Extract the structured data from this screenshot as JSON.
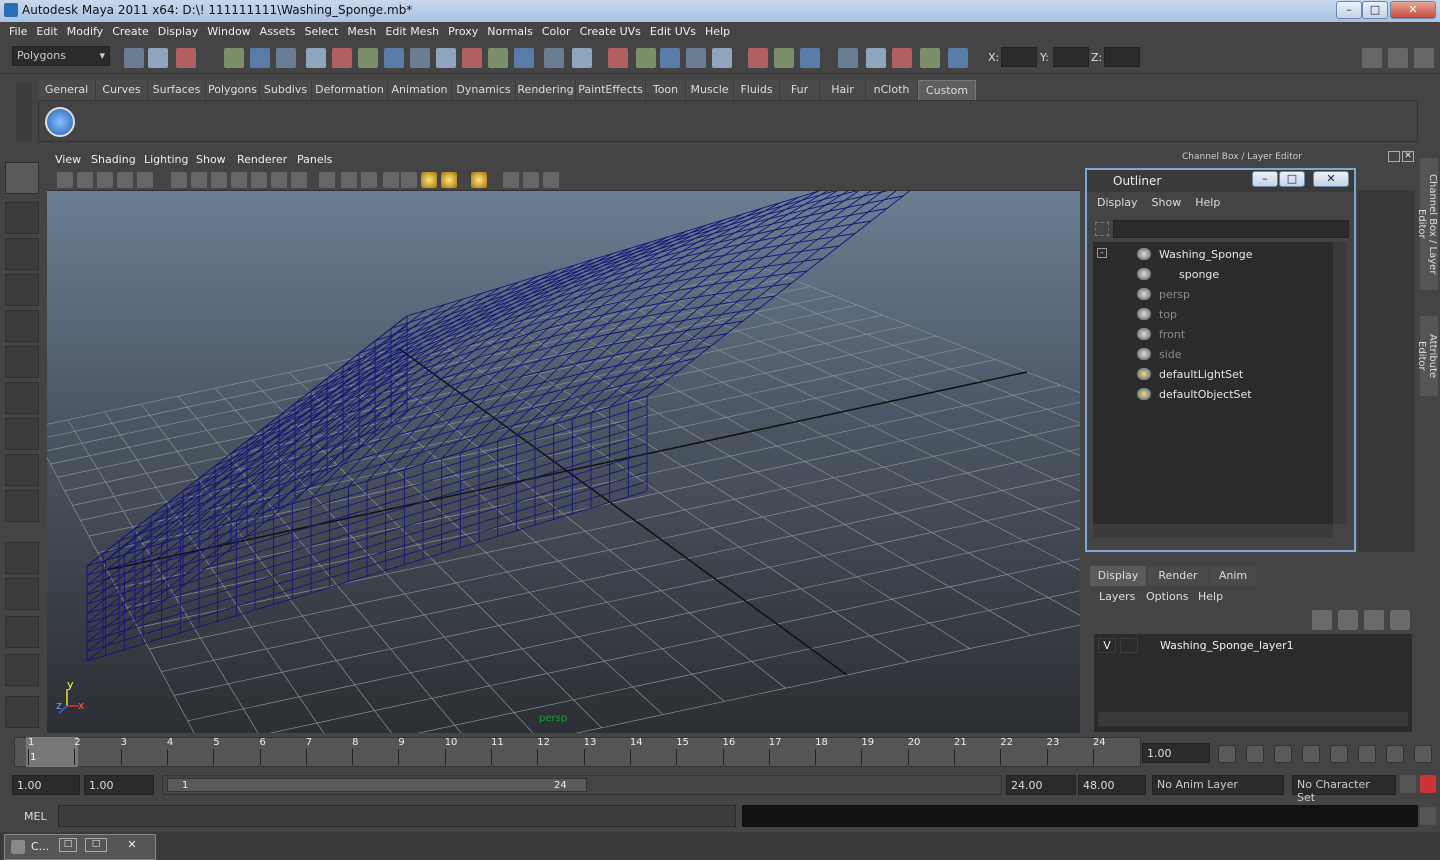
{
  "window": {
    "title": "Autodesk Maya 2011 x64: D:\\! 111111111\\Washing_Sponge.mb*"
  },
  "menubar": [
    "File",
    "Edit",
    "Modify",
    "Create",
    "Display",
    "Window",
    "Assets",
    "Select",
    "Mesh",
    "Edit Mesh",
    "Proxy",
    "Normals",
    "Color",
    "Create UVs",
    "Edit UVs",
    "Help"
  ],
  "statusline": {
    "mode": "Polygons",
    "x_label": "X:",
    "y_label": "Y:",
    "z_label": "Z:"
  },
  "shelf_tabs": [
    "General",
    "Curves",
    "Surfaces",
    "Polygons",
    "Subdivs",
    "Deformation",
    "Animation",
    "Dynamics",
    "Rendering",
    "PaintEffects",
    "Toon",
    "Muscle",
    "Fluids",
    "Fur",
    "Hair",
    "nCloth",
    "Custom"
  ],
  "shelf_selected": "Custom",
  "viewport_menu": [
    "View",
    "Shading",
    "Lighting",
    "Show",
    "Renderer",
    "Panels"
  ],
  "viewport": {
    "camera_label": "persp",
    "axis_x": "x",
    "axis_y": "y",
    "axis_z": "z"
  },
  "channel_box_title": "Channel Box / Layer Editor",
  "outliner": {
    "title": "Outliner",
    "menu": [
      "Display",
      "Show",
      "Help"
    ],
    "items": [
      {
        "label": "Washing_Sponge",
        "dim": false
      },
      {
        "label": "sponge",
        "dim": false
      },
      {
        "label": "persp",
        "dim": true
      },
      {
        "label": "top",
        "dim": true
      },
      {
        "label": "front",
        "dim": true
      },
      {
        "label": "side",
        "dim": true
      },
      {
        "label": "defaultLightSet",
        "dim": false
      },
      {
        "label": "defaultObjectSet",
        "dim": false
      }
    ]
  },
  "side_tabs": [
    "Channel Box / Layer Editor",
    "Attribute Editor"
  ],
  "layer_editor": {
    "tabs": [
      "Display",
      "Render",
      "Anim"
    ],
    "menu": [
      "Layers",
      "Options",
      "Help"
    ],
    "layer": {
      "visible": "V",
      "name": "Washing_Sponge_layer1"
    }
  },
  "timeline": {
    "frames": [
      "1",
      "2",
      "3",
      "4",
      "5",
      "6",
      "7",
      "8",
      "9",
      "10",
      "11",
      "12",
      "13",
      "14",
      "15",
      "16",
      "17",
      "18",
      "19",
      "20",
      "21",
      "22",
      "23",
      "24"
    ],
    "current_time": "1.00",
    "current_frame_marker": "1"
  },
  "range": {
    "start": "1.00",
    "playback_start": "1.00",
    "range_start_label": "1",
    "range_end_label": "24",
    "playback_end": "24.00",
    "end": "48.00",
    "anim_layer": "No Anim Layer",
    "character_set": "No Character Set"
  },
  "command": {
    "label": "MEL"
  },
  "taskbar": {
    "window_label": "C..."
  }
}
